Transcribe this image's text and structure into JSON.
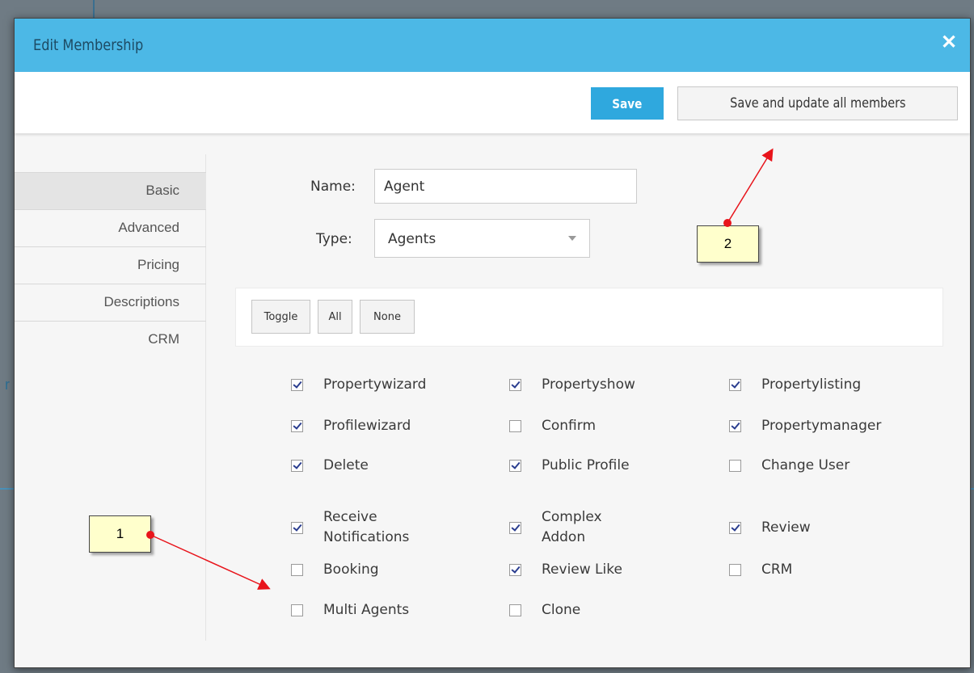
{
  "modal": {
    "title": "Edit Membership",
    "close_icon": "close-icon",
    "save_label": "Save",
    "save_update_label": "Save and update all members"
  },
  "sidebar": {
    "items": [
      {
        "label": "Basic",
        "active": true
      },
      {
        "label": "Advanced",
        "active": false
      },
      {
        "label": "Pricing",
        "active": false
      },
      {
        "label": "Descriptions",
        "active": false
      },
      {
        "label": "CRM",
        "active": false
      }
    ]
  },
  "form": {
    "name_label": "Name:",
    "name_value": "Agent",
    "type_label": "Type:",
    "type_value": "Agents"
  },
  "permission_buttons": {
    "toggle": "Toggle",
    "all": "All",
    "none": "None"
  },
  "permissions": [
    {
      "label": "Propertywizard",
      "checked": true
    },
    {
      "label": "Propertyshow",
      "checked": true
    },
    {
      "label": "Propertylisting",
      "checked": true
    },
    {
      "label": "Profilewizard",
      "checked": true
    },
    {
      "label": "Confirm",
      "checked": false
    },
    {
      "label": "Propertymanager",
      "checked": true
    },
    {
      "label": "Delete",
      "checked": true
    },
    {
      "label": "Public Profile",
      "checked": true
    },
    {
      "label": "Change User",
      "checked": false
    },
    {
      "label": "Receive Notifications",
      "checked": true
    },
    {
      "label": "Complex Addon",
      "checked": true
    },
    {
      "label": "Review",
      "checked": true
    },
    {
      "label": "Booking",
      "checked": false
    },
    {
      "label": "Review Like",
      "checked": true
    },
    {
      "label": "CRM",
      "checked": false
    },
    {
      "label": "Multi Agents",
      "checked": false
    },
    {
      "label": "Clone",
      "checked": false
    }
  ],
  "annotations": {
    "callout_1": "1",
    "callout_2": "2",
    "arrow_color": "#e8141b"
  },
  "colors": {
    "header": "#4cb8e6",
    "save_button": "#2fa8de",
    "callout_bg": "#ffffcc"
  }
}
